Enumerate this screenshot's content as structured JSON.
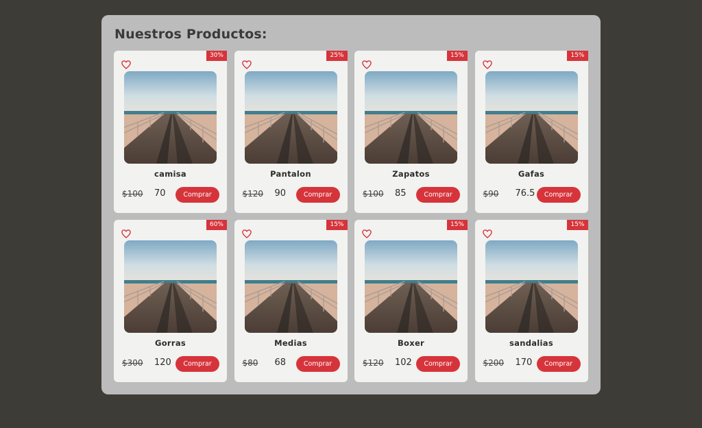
{
  "section_title": "Nuestros Productos:",
  "buy_label": "Comprar",
  "colors": {
    "page_background": "#3d3c37",
    "panel_background": "#bcbcbc",
    "card_background": "#f2f2f0",
    "accent": "#d6343b"
  },
  "icons": {
    "favorite": "heart-outline-icon"
  },
  "products": [
    {
      "name": "camisa",
      "discount": "30%",
      "old_price": "$100",
      "price": "70"
    },
    {
      "name": "Pantalon",
      "discount": "25%",
      "old_price": "$120",
      "price": "90"
    },
    {
      "name": "Zapatos",
      "discount": "15%",
      "old_price": "$100",
      "price": "85"
    },
    {
      "name": "Gafas",
      "discount": "15%",
      "old_price": "$90",
      "price": "76.5"
    },
    {
      "name": "Gorras",
      "discount": "60%",
      "old_price": "$300",
      "price": "120"
    },
    {
      "name": "Medias",
      "discount": "15%",
      "old_price": "$80",
      "price": "68"
    },
    {
      "name": "Boxer",
      "discount": "15%",
      "old_price": "$120",
      "price": "102"
    },
    {
      "name": "sandalias",
      "discount": "15%",
      "old_price": "$200",
      "price": "170"
    }
  ]
}
